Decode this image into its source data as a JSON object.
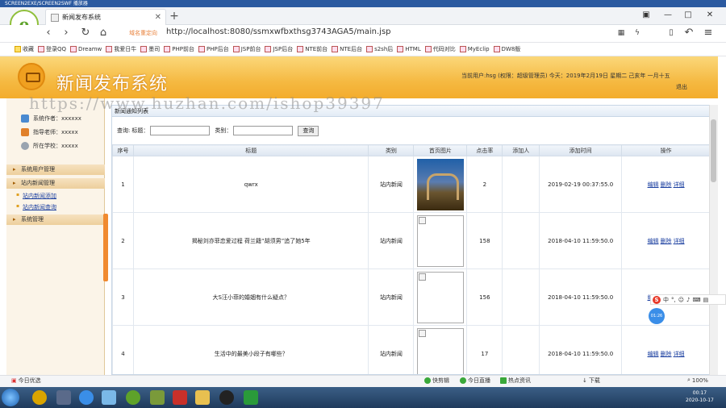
{
  "player_title": "SCREEN2EXE/SCREEN2SWF 播放器",
  "browser": {
    "tab_title": "新闻发布系统",
    "redirect_label": "域名重定向",
    "url": "http://localhost:8080/ssmxwfbxthsg3743AGA5/main.jsp",
    "bookmarks": [
      "收藏",
      "登录QQ",
      "Dreamw",
      "我爱日牛",
      "墨司",
      "PHP前台",
      "PHP后台",
      "JSP前台",
      "JSP后台",
      "NTE前台",
      "NTE后台",
      "s2sh后",
      "HTML",
      "代码对比",
      "MyEclip",
      "DW8版"
    ]
  },
  "app": {
    "title": "新闻发布系统",
    "user_info": "当前用户:hsg (权限：超级管理员) 今天：2019年2月19日 星期二 己亥年 一月十五",
    "logout": "退出"
  },
  "sidebar": {
    "info": [
      {
        "label": "系统作者：xxxxxx"
      },
      {
        "label": "指导老师：xxxxx"
      },
      {
        "label": "所在学校：xxxxx"
      }
    ],
    "sections": [
      {
        "label": "系统用户管理"
      },
      {
        "label": "站内新闻管理"
      },
      {
        "label": "系统管理"
      }
    ],
    "links": [
      {
        "label": "站内新闻添加"
      },
      {
        "label": "站内新闻查询"
      }
    ]
  },
  "content": {
    "panel_title": "新闻通知列表",
    "search": {
      "prefix": "查询:",
      "title_label": "标题：",
      "category_label": "类别：",
      "button": "查询"
    },
    "columns": [
      "序号",
      "标题",
      "类别",
      "首页图片",
      "点击率",
      "添加人",
      "添加时间",
      "操作"
    ],
    "rows": [
      {
        "no": "1",
        "title": "qwrx",
        "category": "站内新闻",
        "image": "photo",
        "clicks": "2",
        "adder": "",
        "time": "2019-02-19 00:37:55.0"
      },
      {
        "no": "2",
        "title": "揭秘刘亦菲恋爱过程 荷兰籍“胡须男”追了她5年",
        "category": "站内新闻",
        "image": "broken",
        "clicks": "158",
        "adder": "",
        "time": "2018-04-10 11:59:50.0"
      },
      {
        "no": "3",
        "title": "大S汪小菲的婚姻有什么疑点？",
        "category": "站内新闻",
        "image": "broken",
        "clicks": "156",
        "adder": "",
        "time": "2018-04-10 11:59:50.0"
      },
      {
        "no": "4",
        "title": "生活中的最美小段子有哪些？",
        "category": "站内新闻",
        "image": "broken",
        "clicks": "17",
        "adder": "",
        "time": "2018-04-10 11:59:50.0"
      }
    ],
    "ops": {
      "edit": "编辑",
      "delete": "删除",
      "detail": "详细"
    }
  },
  "watermark": "https://www.huzhan.com/ishop39397",
  "ime": {
    "label": "中"
  },
  "rec_badge": "01:26",
  "statusbar": {
    "left": "今日优选",
    "items": [
      "快剪辑",
      "今日直播",
      "热点资讯"
    ],
    "download": "下载",
    "zoom": "100%"
  },
  "taskbar": {
    "time": "00:17",
    "date": "2020-10-17"
  }
}
